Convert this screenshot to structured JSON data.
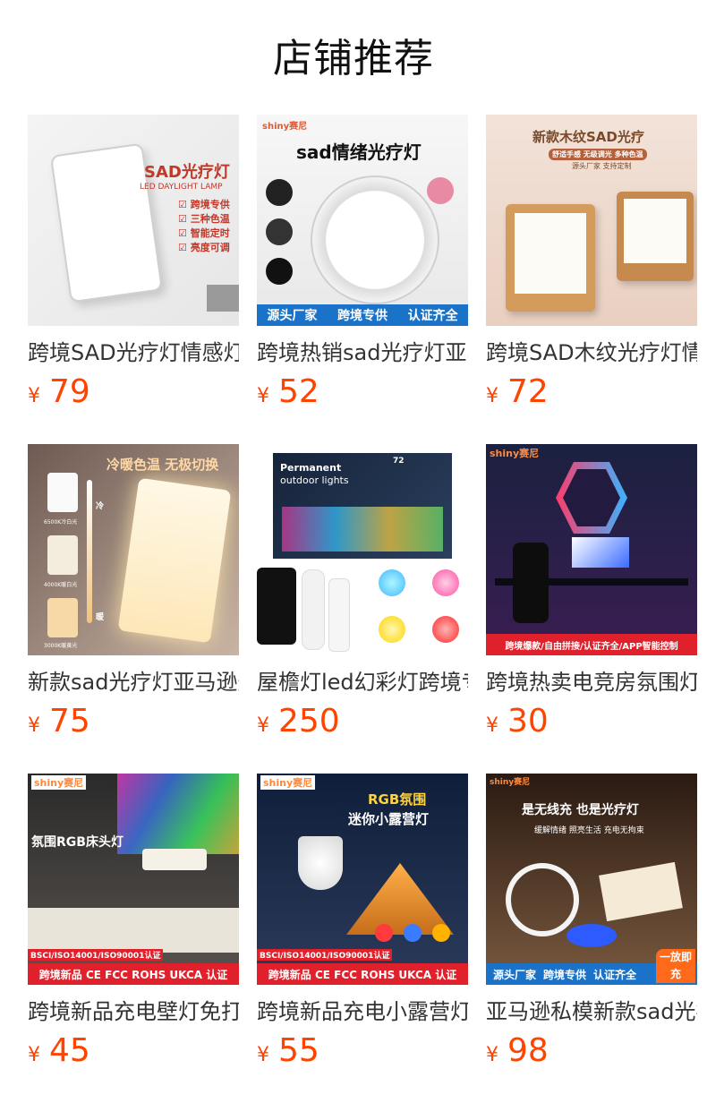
{
  "page": {
    "title": "店铺推荐"
  },
  "products": [
    {
      "title": "跨境SAD光疗灯情感灯",
      "currency": "¥",
      "price": "79",
      "image": {
        "heading": "SAD光疗灯",
        "sub": "LED DAYLIGHT LAMP",
        "features": [
          "☑ 跨境专供",
          "☑ 三种色温",
          "☑ 智能定时",
          "☑ 亮度可调"
        ]
      }
    },
    {
      "title": "跨境热销sad光疗灯亚马逊",
      "currency": "¥",
      "price": "52",
      "image": {
        "brand": "shiny赛尼",
        "heading": "sad情绪光疗灯",
        "banner": [
          "源头厂家",
          "跨境专供",
          "认证齐全"
        ]
      }
    },
    {
      "title": "跨境SAD木纹光疗灯情感",
      "currency": "¥",
      "price": "72",
      "image": {
        "heading": "新款木纹SAD光疗",
        "sub": "舒适手感 无级调光 多种色温",
        "note": "源头厂家 支持定制"
      }
    },
    {
      "title": "新款sad光疗灯亚马逊爆款",
      "currency": "¥",
      "price": "75",
      "image": {
        "heading": "冷暖色温 无极切换",
        "labels": [
          "6500K冷白光",
          "4000K暖白光",
          "3000K暖黄光"
        ],
        "cold": "冷",
        "warm": "暖"
      }
    },
    {
      "title": "屋檐灯led幻彩灯跨境专供",
      "currency": "¥",
      "price": "250",
      "image": {
        "heading": "Permanent",
        "sub": "outdoor lights",
        "count": "72"
      }
    },
    {
      "title": "跨境热卖电竞房氛围灯",
      "currency": "¥",
      "price": "30",
      "image": {
        "brand": "shiny赛尼",
        "banner": "跨境爆款/自由拼接/认证齐全/APP智能控制"
      }
    },
    {
      "title": "跨境新品充电壁灯免打孔",
      "currency": "¥",
      "price": "45",
      "image": {
        "brand": "shiny赛尼",
        "heading": "氛围RGB床头灯",
        "cert": "BSCI/ISO14001/ISO90001认证",
        "banner": "跨境新品 CE FCC ROHS UKCA 认证"
      }
    },
    {
      "title": "跨境新品充电小露营灯",
      "currency": "¥",
      "price": "55",
      "image": {
        "brand": "shiny赛尼",
        "heading": "RGB氛围",
        "heading2": "迷你小露营灯",
        "cert": "BSCI/ISO14001/ISO90001认证",
        "banner": "跨境新品 CE FCC ROHS UKCA 认证"
      }
    },
    {
      "title": "亚马逊私模新款sad光疗灯",
      "currency": "¥",
      "price": "98",
      "image": {
        "brand": "shiny赛尼",
        "heading": "是无线充 也是光疗灯",
        "sub": "缓解情绪 照亮生活 充电无拘束",
        "banner": [
          "源头厂家",
          "跨境专供",
          "认证齐全"
        ],
        "badge": "一放即充"
      }
    }
  ],
  "colors": {
    "price": "#ff4400",
    "title": "#333333",
    "banner_blue": "#1a73c8",
    "banner_red": "#e0202a"
  }
}
